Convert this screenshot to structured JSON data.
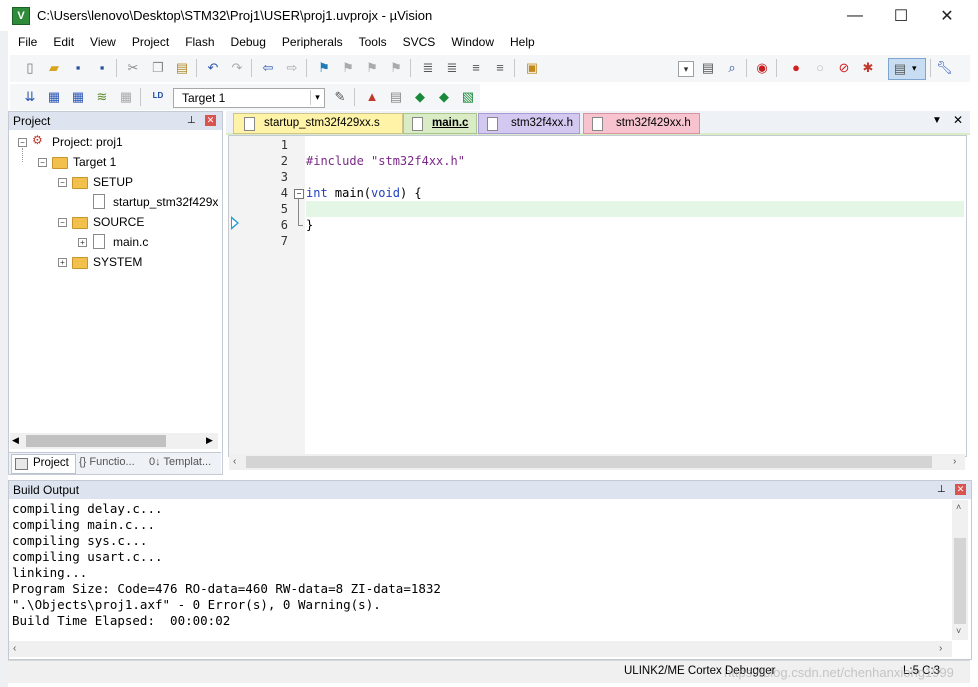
{
  "window": {
    "title": "C:\\Users\\lenovo\\Desktop\\STM32\\Proj1\\USER\\proj1.uvprojx - µVision",
    "minimize_glyph": "—",
    "maximize_glyph": "☐",
    "close_glyph": "✕"
  },
  "menu": [
    "File",
    "Edit",
    "View",
    "Project",
    "Flash",
    "Debug",
    "Peripherals",
    "Tools",
    "SVCS",
    "Window",
    "Help"
  ],
  "toolbar2": {
    "target_select": "Target 1"
  },
  "project_panel": {
    "title": "Project",
    "tree": {
      "root": "Project: proj1",
      "target": "Target 1",
      "groups": [
        {
          "name": "SETUP",
          "files": [
            "startup_stm32f429xx.s"
          ]
        },
        {
          "name": "SOURCE",
          "files": [
            "main.c"
          ]
        },
        {
          "name": "SYSTEM",
          "files": []
        }
      ]
    },
    "bottom_tabs": [
      "Project",
      "{} Functio...",
      "0↓ Templat..."
    ]
  },
  "editor": {
    "tabs": [
      {
        "label": "startup_stm32f429xx.s",
        "color": "#fff3a8",
        "active": false
      },
      {
        "label": "main.c",
        "color": "#d9ecc6",
        "active": true
      },
      {
        "label": "stm32f4xx.h",
        "color": "#d3c9f0",
        "active": false
      },
      {
        "label": "stm32f429xx.h",
        "color": "#f6c3cf",
        "active": false
      }
    ],
    "lines": [
      {
        "n": "1",
        "text": ""
      },
      {
        "n": "2",
        "text": "#include \"stm32f4xx.h\""
      },
      {
        "n": "3",
        "text": ""
      },
      {
        "n": "4",
        "text": "int main(void) {"
      },
      {
        "n": "5",
        "text": ""
      },
      {
        "n": "6",
        "text": "}"
      },
      {
        "n": "7",
        "text": ""
      }
    ],
    "current_line": 5
  },
  "build_output": {
    "title": "Build Output",
    "lines": [
      "compiling delay.c...",
      "compiling main.c...",
      "compiling sys.c...",
      "compiling usart.c...",
      "linking...",
      "Program Size: Code=476 RO-data=460 RW-data=8 ZI-data=1832",
      "\".\\Objects\\proj1.axf\" - 0 Error(s), 0 Warning(s).",
      "Build Time Elapsed:  00:00:02"
    ]
  },
  "statusbar": {
    "debugger": "ULINK2/ME Cortex Debugger",
    "position": "L:5 C:3",
    "watermark": "https://blog.csdn.net/chenhanxiong1999"
  }
}
